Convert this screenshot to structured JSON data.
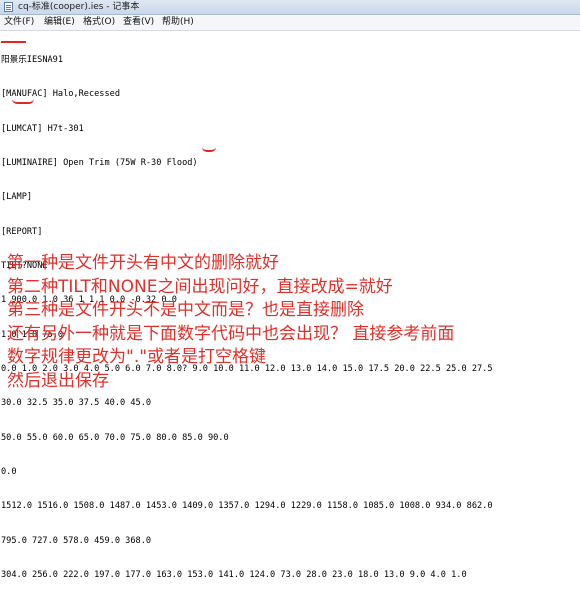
{
  "window": {
    "title": "cq-标准(cooper).ies - 记事本"
  },
  "menu": [
    {
      "label": "文件(F)"
    },
    {
      "label": "编辑(E)"
    },
    {
      "label": "格式(O)"
    },
    {
      "label": "查看(V)"
    },
    {
      "label": "帮助(H)"
    }
  ],
  "document": {
    "lines": [
      "IESNA91",
      "[MANUFAC] Halo,Recessed",
      "[LUMCAT] H7t-301",
      "[LUMINAIRE] Open Trim (75W R-30 Flood)",
      "[LAMP]",
      "[REPORT]",
      "TILT?NONE",
      "1 900.0 1.0 36 1 1 1 0.0 -0.32 0.0",
      "1.0 1.0 75.0",
      "0.0 1.0 2.0 3.0 4.0 5.0 6.0 7.0 8.0? 9.0 10.0 11.0 12.0 13.0 14.0 15.0 17.5 20.0 22.5 25.0 27.5",
      "30.0 32.5 35.0 37.5 40.0 45.0",
      "50.0 55.0 60.0 65.0 70.0 75.0 80.0 85.0 90.0",
      "0.0",
      "1512.0 1516.0 1508.0 1487.0 1453.0 1409.0 1357.0 1294.0 1229.0 1158.0 1085.0 1008.0 934.0 862.0",
      "795.0 727.0 578.0 459.0 368.0",
      "304.0 256.0 222.0 197.0 177.0 163.0 153.0 141.0 124.0 73.0 28.0 23.0 18.0 13.0 9.0 4.0 1.0"
    ],
    "stray_text": "阳景乐"
  },
  "notes": [
    "第一种是文件开头有中文的删除就好",
    "第二种TILT和NONE之间出现问好，直接改成=就好",
    "第三种是文件开头不是中文而是？也是直接删除",
    "还有另外一种就是下面数字代码中也会出现？ 直接参考前面",
    "数字规律更改为\".\"或者是打空格键",
    "然后退出保存"
  ],
  "colors": {
    "annotation_red": "#e0302b",
    "titlebar": "#dfe8f3"
  }
}
